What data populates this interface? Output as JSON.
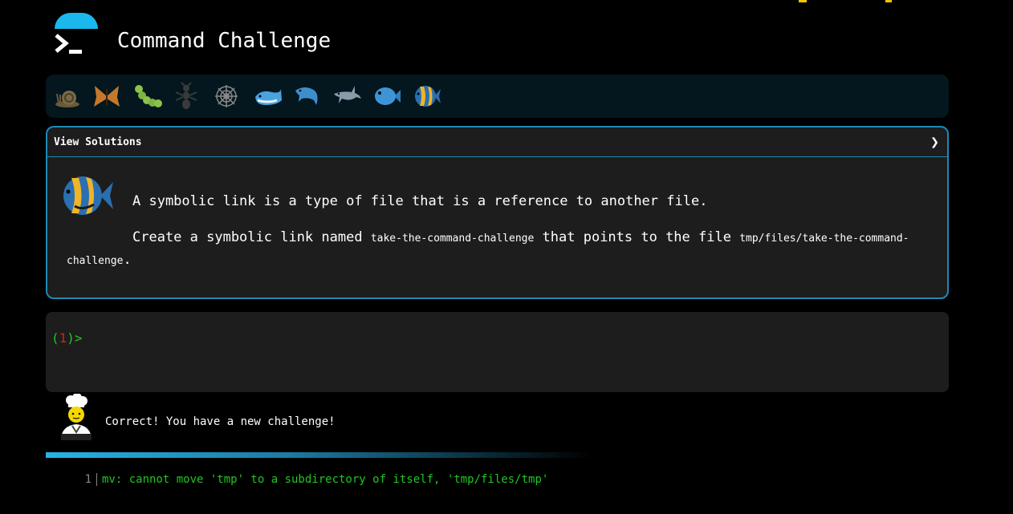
{
  "header": {
    "title": "Command Challenge"
  },
  "icons": [
    {
      "name": "snail-icon"
    },
    {
      "name": "butterfly-icon"
    },
    {
      "name": "caterpillar-icon"
    },
    {
      "name": "ant-icon"
    },
    {
      "name": "spider-web-icon"
    },
    {
      "name": "whale-icon"
    },
    {
      "name": "dolphin-icon"
    },
    {
      "name": "shark-icon"
    },
    {
      "name": "blowfish-icon"
    },
    {
      "name": "tropical-fish-icon"
    }
  ],
  "challenge": {
    "view_solutions": "View Solutions",
    "chevron": "❯",
    "line1": "A symbolic link is a type of file that is a reference to another file.",
    "line2_prefix": "Create a symbolic link named ",
    "link_name": "take-the-command-challenge",
    "line2_middle": " that points to the file ",
    "target_path": "tmp/files/take-the-command-challenge",
    "line2_suffix": "."
  },
  "terminal": {
    "prompt_open": "(",
    "prompt_number": "1",
    "prompt_close": ")>"
  },
  "feedback": {
    "message": "Correct! You have a new challenge!"
  },
  "output": {
    "line_number": "1",
    "text": "mv: cannot move 'tmp' to a subdirectory of itself, 'tmp/files/tmp'"
  },
  "colors": {
    "accent": "#1ab8ec",
    "panel_border": "#1e8ab5",
    "prompt_green": "#21c521",
    "prompt_red": "#e01b1b"
  }
}
